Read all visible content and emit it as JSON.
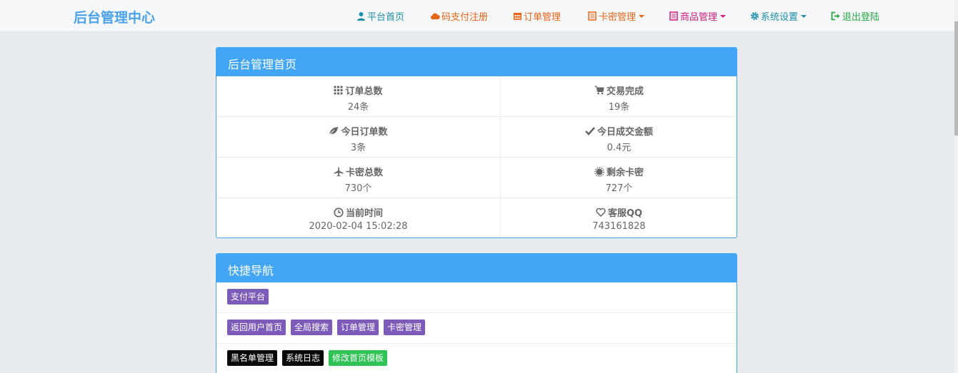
{
  "brand": "后台管理中心",
  "nav": [
    {
      "label": "平台首页",
      "icon": "user-icon",
      "color": "#1e8fa8"
    },
    {
      "label": "码支付注册",
      "icon": "cloud-icon",
      "color": "#e8661c"
    },
    {
      "label": "订单管理",
      "icon": "calendar-icon",
      "color": "#e8661c"
    },
    {
      "label": "卡密管理",
      "icon": "list-icon",
      "color": "#e8661c"
    },
    {
      "label": "商品管理",
      "icon": "list-icon",
      "color": "#d01c7c"
    },
    {
      "label": "系统设置",
      "icon": "gear-icon",
      "color": "#1e8fa8"
    },
    {
      "label": "退出登陆",
      "icon": "logout-icon",
      "color": "#27a844"
    }
  ],
  "dashboard": {
    "title": "后台管理首页",
    "stats": [
      {
        "label": "订单总数",
        "value": "24条",
        "icon": "grid-icon"
      },
      {
        "label": "交易完成",
        "value": "19条",
        "icon": "cart-icon"
      },
      {
        "label": "今日订单数",
        "value": "3条",
        "icon": "leaf-icon"
      },
      {
        "label": "今日成交金额",
        "value": "0.4元",
        "icon": "check-icon"
      },
      {
        "label": "卡密总数",
        "value": "730个",
        "icon": "plane-icon"
      },
      {
        "label": "剩余卡密",
        "value": "727个",
        "icon": "sun-icon"
      },
      {
        "label": "当前时间",
        "value": "2020-02-04 15:02:28",
        "icon": "clock-icon"
      },
      {
        "label": "客服QQ",
        "value": "743161828",
        "icon": "heart-icon"
      }
    ]
  },
  "quicknav": {
    "title": "快捷导航",
    "rows": [
      [
        "支付平台"
      ],
      [
        "返回用户首页",
        "全局搜索",
        "订单管理",
        "卡密管理"
      ],
      [
        "黑名单管理",
        "系统日志",
        "修改首页模板"
      ]
    ]
  },
  "colors": {
    "accent": "#42a5f5",
    "brand": "#4aa3ea",
    "tag_purple": "#7c5cb8",
    "tag_black": "#0a0a0a",
    "tag_green": "#2ec455"
  }
}
